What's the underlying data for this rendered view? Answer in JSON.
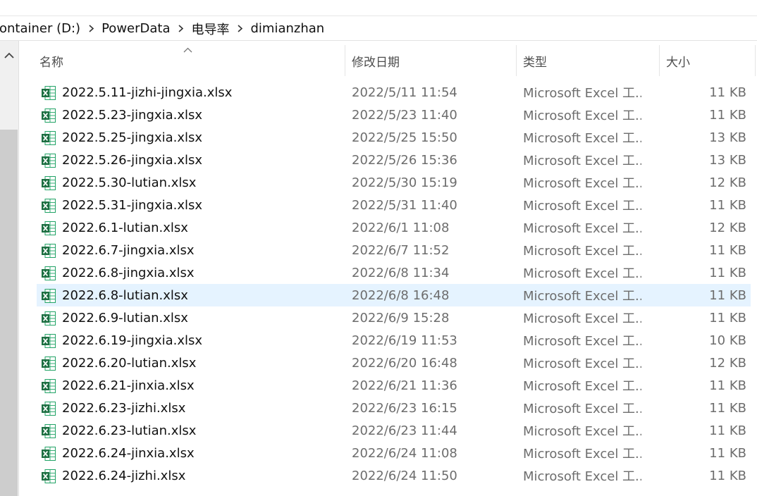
{
  "breadcrumb": {
    "items": [
      "ontainer (D:)",
      "PowerData",
      "电导率",
      "dimianzhan"
    ]
  },
  "columns": {
    "name": "名称",
    "date": "修改日期",
    "type": "类型",
    "size": "大小"
  },
  "icons": {
    "file": "excel-file-icon",
    "separator": "chevron-right-icon",
    "sort": "sort-ascending-icon",
    "scroll": "scroll-up-icon"
  },
  "colors": {
    "excel_green": "#1d6f42",
    "hover_row": "#e5f3ff"
  },
  "files": [
    {
      "name": "2022.5.11-jizhi-jingxia.xlsx",
      "date": "2022/5/11 11:54",
      "type": "Microsoft Excel 工...",
      "size": "11 KB"
    },
    {
      "name": "2022.5.23-jingxia.xlsx",
      "date": "2022/5/23 11:40",
      "type": "Microsoft Excel 工...",
      "size": "11 KB"
    },
    {
      "name": "2022.5.25-jingxia.xlsx",
      "date": "2022/5/25 15:50",
      "type": "Microsoft Excel 工...",
      "size": "13 KB"
    },
    {
      "name": "2022.5.26-jingxia.xlsx",
      "date": "2022/5/26 15:36",
      "type": "Microsoft Excel 工...",
      "size": "13 KB"
    },
    {
      "name": "2022.5.30-lutian.xlsx",
      "date": "2022/5/30 15:19",
      "type": "Microsoft Excel 工...",
      "size": "12 KB"
    },
    {
      "name": "2022.5.31-jingxia.xlsx",
      "date": "2022/5/31 11:40",
      "type": "Microsoft Excel 工...",
      "size": "11 KB"
    },
    {
      "name": "2022.6.1-lutian.xlsx",
      "date": "2022/6/1 11:08",
      "type": "Microsoft Excel 工...",
      "size": "12 KB"
    },
    {
      "name": "2022.6.7-jingxia.xlsx",
      "date": "2022/6/7 11:52",
      "type": "Microsoft Excel 工...",
      "size": "11 KB"
    },
    {
      "name": "2022.6.8-jingxia.xlsx",
      "date": "2022/6/8 11:34",
      "type": "Microsoft Excel 工...",
      "size": "11 KB"
    },
    {
      "name": "2022.6.8-lutian.xlsx",
      "date": "2022/6/8 16:48",
      "type": "Microsoft Excel 工...",
      "size": "11 KB"
    },
    {
      "name": "2022.6.9-lutian.xlsx",
      "date": "2022/6/9 15:28",
      "type": "Microsoft Excel 工...",
      "size": "11 KB"
    },
    {
      "name": "2022.6.19-jingxia.xlsx",
      "date": "2022/6/19 11:53",
      "type": "Microsoft Excel 工...",
      "size": "10 KB"
    },
    {
      "name": "2022.6.20-lutian.xlsx",
      "date": "2022/6/20 16:48",
      "type": "Microsoft Excel 工...",
      "size": "12 KB"
    },
    {
      "name": "2022.6.21-jinxia.xlsx",
      "date": "2022/6/21 11:36",
      "type": "Microsoft Excel 工...",
      "size": "11 KB"
    },
    {
      "name": "2022.6.23-jizhi.xlsx",
      "date": "2022/6/23 16:15",
      "type": "Microsoft Excel 工...",
      "size": "11 KB"
    },
    {
      "name": "2022.6.23-lutian.xlsx",
      "date": "2022/6/23 11:44",
      "type": "Microsoft Excel 工...",
      "size": "11 KB"
    },
    {
      "name": "2022.6.24-jinxia.xlsx",
      "date": "2022/6/24 11:08",
      "type": "Microsoft Excel 工...",
      "size": "11 KB"
    },
    {
      "name": "2022.6.24-jizhi.xlsx",
      "date": "2022/6/24 11:50",
      "type": "Microsoft Excel 工...",
      "size": "11 KB"
    }
  ]
}
